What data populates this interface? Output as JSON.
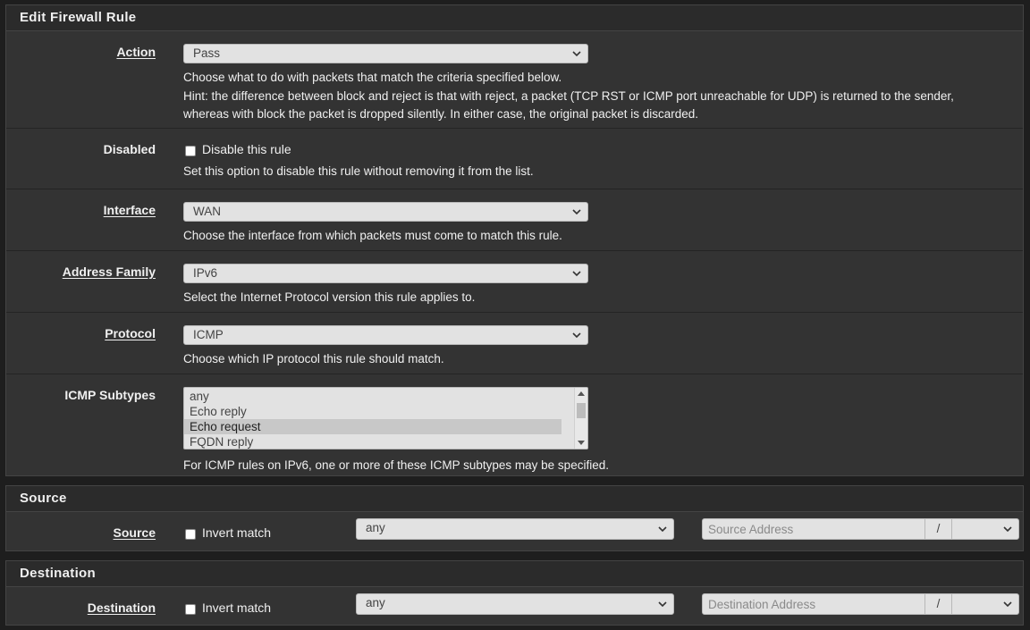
{
  "edit_panel": {
    "title": "Edit Firewall Rule",
    "action": {
      "label": "Action",
      "value": "Pass",
      "help": [
        "Choose what to do with packets that match the criteria specified below.",
        "Hint: the difference between block and reject is that with reject, a packet (TCP RST or ICMP port unreachable for UDP) is returned to the sender,",
        "whereas with block the packet is dropped silently. In either case, the original packet is discarded."
      ]
    },
    "disabled": {
      "label": "Disabled",
      "checkbox_label": "Disable this rule",
      "checked": false,
      "help": "Set this option to disable this rule without removing it from the list."
    },
    "interface": {
      "label": "Interface",
      "value": "WAN",
      "help": "Choose the interface from which packets must come to match this rule."
    },
    "address_family": {
      "label": "Address Family",
      "value": "IPv6",
      "help": "Select the Internet Protocol version this rule applies to."
    },
    "protocol": {
      "label": "Protocol",
      "value": "ICMP",
      "help": "Choose which IP protocol this rule should match."
    },
    "icmp_subtypes": {
      "label": "ICMP Subtypes",
      "options": [
        "any",
        "Echo reply",
        "Echo request",
        "FQDN reply"
      ],
      "selected_index": 2,
      "help": "For ICMP rules on IPv6, one or more of these ICMP subtypes may be specified."
    }
  },
  "source_panel": {
    "title": "Source",
    "label": "Source",
    "invert_label": "Invert match",
    "invert_checked": false,
    "type_value": "any",
    "address_placeholder": "Source Address",
    "slash": "/",
    "mask_value": ""
  },
  "destination_panel": {
    "title": "Destination",
    "label": "Destination",
    "invert_label": "Invert match",
    "invert_checked": false,
    "type_value": "any",
    "address_placeholder": "Destination Address",
    "slash": "/",
    "mask_value": ""
  },
  "icons": {
    "dropdown": "chevron-down-icon",
    "scroll_up": "arrow-up-icon",
    "scroll_down": "arrow-down-icon"
  },
  "colors": {
    "background": "#1e1e1e",
    "panel": "#333333",
    "panel_header": "#2b2b2b",
    "input_bg": "#e2e2e2",
    "text": "#f0f0f0"
  }
}
